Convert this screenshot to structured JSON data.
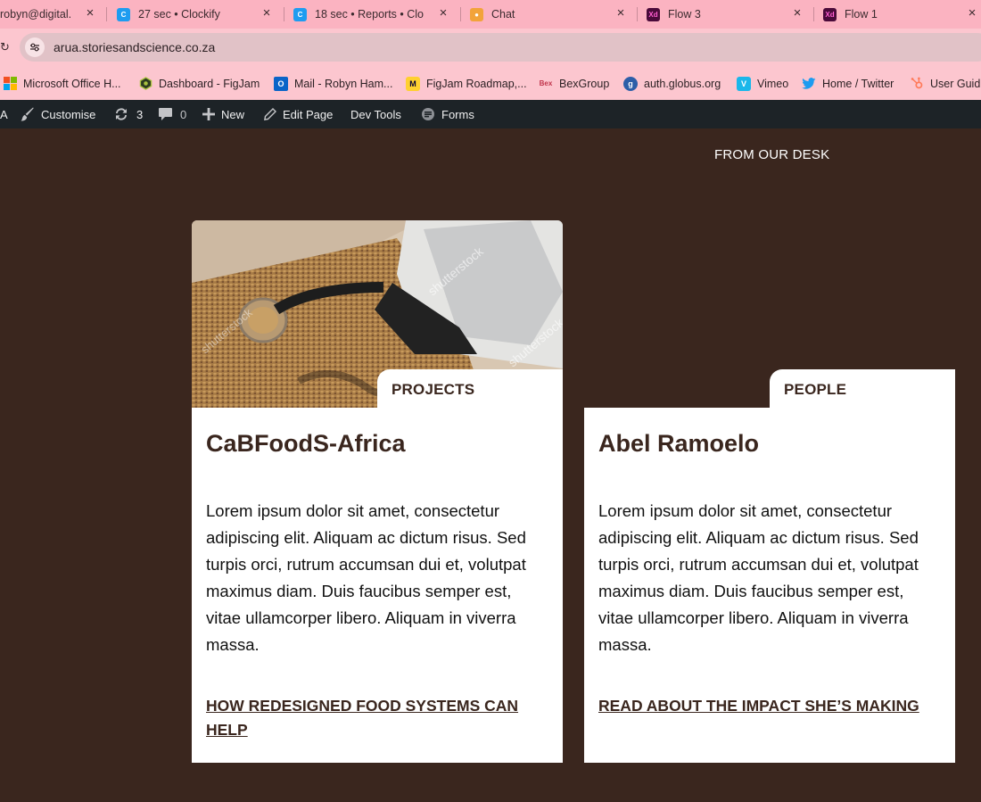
{
  "browser": {
    "tabs": [
      {
        "title": "robyn@digital.",
        "icon": "mail-icon"
      },
      {
        "title": "27 sec • Clockify",
        "icon": "clockify-icon"
      },
      {
        "title": "18 sec • Reports • Clo",
        "icon": "clockify-icon"
      },
      {
        "title": "Chat",
        "icon": "chat-icon"
      },
      {
        "title": "Flow 3",
        "icon": "xd-icon",
        "icon_text": "Xd"
      },
      {
        "title": "Flow 1",
        "icon": "xd-icon",
        "icon_text": "Xd"
      }
    ],
    "url": "arua.storiesandscience.co.za",
    "bookmarks": [
      {
        "label": "Microsoft Office H...",
        "icon": "microsoft-icon"
      },
      {
        "label": "Dashboard - FigJam",
        "icon": "figjam-icon"
      },
      {
        "label": "Mail - Robyn Ham...",
        "icon": "outlook-icon",
        "icon_text": "O"
      },
      {
        "label": "FigJam Roadmap,...",
        "icon": "miro-icon",
        "icon_text": "M"
      },
      {
        "label": "BexGroup",
        "icon": "bex-icon",
        "icon_text": "Bex"
      },
      {
        "label": "auth.globus.org",
        "icon": "globus-icon",
        "icon_text": "g"
      },
      {
        "label": "Vimeo",
        "icon": "vimeo-icon",
        "icon_text": "V"
      },
      {
        "label": "Home / Twitter",
        "icon": "twitter-icon"
      },
      {
        "label": "User Guid",
        "icon": "hubspot-icon"
      }
    ]
  },
  "adminbar": {
    "fragment": "A",
    "customise": "Customise",
    "updates_count": "3",
    "comments_count": "0",
    "new": "New",
    "edit_page": "Edit Page",
    "dev_tools": "Dev Tools",
    "forms": "Forms"
  },
  "page": {
    "section_title": "FROM OUR DESK",
    "cards": [
      {
        "category": "PROJECTS",
        "title": "CaBFoodS-Africa",
        "body": "Lorem ipsum dolor sit amet, consectetur adipiscing elit. Aliquam ac dictum risus. Sed turpis orci, rutrum accumsan dui et, volutpat maximus diam. Duis faucibus semper est, vitae ullamcorper libero. Aliquam in viverra massa.",
        "link": "HOW REDESIGNED FOOD SYSTEMS CAN HELP"
      },
      {
        "category": "PEOPLE",
        "title": "Abel Ramoelo",
        "body": "Lorem ipsum dolor sit amet, consectetur adipiscing elit. Aliquam ac dictum risus. Sed turpis orci, rutrum accumsan dui et, volutpat maximus diam. Duis faucibus semper est, vitae ullamcorper libero. Aliquam in viverra massa.",
        "link": "READ ABOUT THE IMPACT SHE’S MAKING"
      }
    ],
    "photo_watermark": "shutterstock"
  },
  "colors": {
    "page_bg": "#3a261e",
    "tab_bg": "#fbb3c1",
    "admin_bg": "#1d2327",
    "card_text": "#3a261e"
  }
}
